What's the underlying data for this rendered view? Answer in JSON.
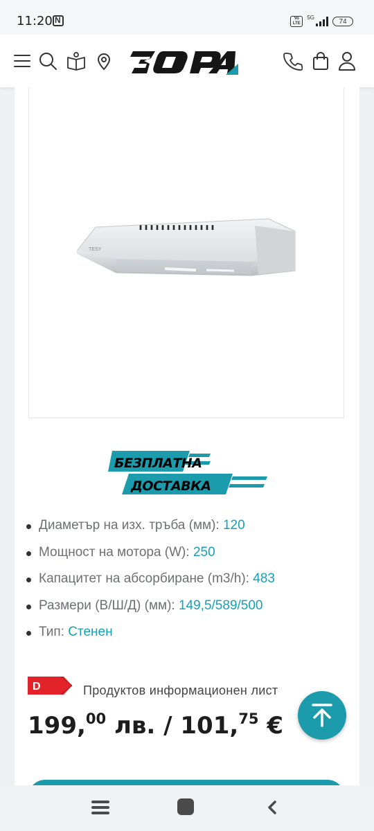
{
  "status_bar": {
    "time": "11:20",
    "network": "5G",
    "volte": "Vo LTE",
    "battery": "74"
  },
  "header": {
    "logo_text": "ЗОРА",
    "icons": [
      "menu-icon",
      "search-icon",
      "catalog-icon",
      "location-icon",
      "phone-icon",
      "cart-icon",
      "user-icon"
    ]
  },
  "product": {
    "image_brand_text": "TESY",
    "delivery_badge": {
      "line1": "БЕЗПЛАТНА",
      "line2": "ДОСТАВКА"
    },
    "specs": [
      {
        "label": "Диаметър на изх. тръба (мм): ",
        "value": "120"
      },
      {
        "label": "Мощност на мотора (W): ",
        "value": "250"
      },
      {
        "label": "Капацитет на абсорбиране (m3/h): ",
        "value": "483"
      },
      {
        "label": "Размери (В/Ш/Д) (мм): ",
        "value": "149,5/589/500"
      },
      {
        "label": "Тип: ",
        "value": "Стенен"
      }
    ],
    "energy_class": "D",
    "info_sheet_link": "Продуктов информационен лист",
    "price": {
      "bgn_int": "199,",
      "bgn_dec": "00",
      "bgn_unit": " лв. / ",
      "eur_int": "101,",
      "eur_dec": "75",
      "eur_unit": " €"
    }
  },
  "colors": {
    "accent": "#1b9bab",
    "link": "#16a0b5",
    "energy_label": "#e2232a"
  }
}
